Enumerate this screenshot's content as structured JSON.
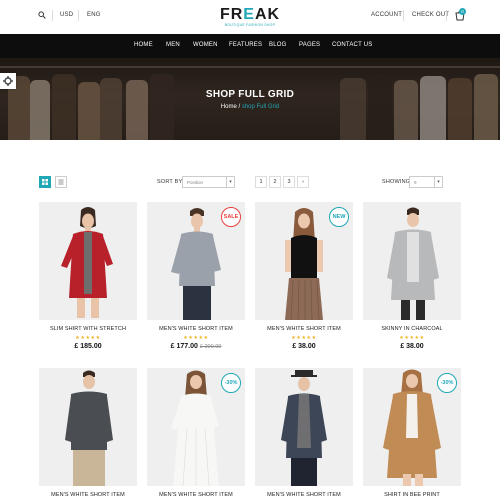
{
  "topbar": {
    "currency": "USD",
    "language": "ENG",
    "account": "ACCOUNT",
    "checkout": "CHECK OUT",
    "cart_count": "0"
  },
  "logo": {
    "main_part1": "FR",
    "main_accent": "E",
    "main_part2": "AK",
    "tagline": "BOUTIQUE FASHION SHOP"
  },
  "nav": {
    "items": [
      "HOME",
      "MEN",
      "WOMEN",
      "FEATURES",
      "BLOG",
      "PAGES",
      "CONTACT US"
    ]
  },
  "hero": {
    "title": "SHOP FULL GRID",
    "breadcrumb_home": "Home",
    "breadcrumb_sep": " / ",
    "breadcrumb_current": "shop Full Grid"
  },
  "toolbar": {
    "sort_label": "SORT BY :",
    "sort_value": "Position",
    "pages": [
      "1",
      "2",
      "3",
      "›"
    ],
    "showing_label": "SHOWING :",
    "showing_value": "9"
  },
  "products": [
    {
      "name": "SLIM SHIRT WITH STRETCH",
      "stars": "★★★★★",
      "price": "£ 185.00",
      "old_price": "",
      "badge": ""
    },
    {
      "name": "MEN'S WHITE SHORT ITEM",
      "stars": "★★★★★",
      "price": "£ 177.00",
      "old_price": "£ 200.00",
      "badge": "SALE"
    },
    {
      "name": "MEN'S WHITE SHORT ITEM",
      "stars": "★★★★★",
      "price": "£ 38.00",
      "old_price": "",
      "badge": "NEW"
    },
    {
      "name": "SKINNY IN CHARCOAL",
      "stars": "★★★★★",
      "price": "£ 38.00",
      "old_price": "",
      "badge": ""
    },
    {
      "name": "MEN'S WHITE SHORT ITEM",
      "stars": "",
      "price": "",
      "old_price": "",
      "badge": ""
    },
    {
      "name": "MEN'S WHITE SHORT ITEM",
      "stars": "",
      "price": "",
      "old_price": "",
      "badge": "-30%"
    },
    {
      "name": "MEN'S WHITE SHORT ITEM",
      "stars": "",
      "price": "",
      "old_price": "",
      "badge": ""
    },
    {
      "name": "SHIRT IN BEE PRINT",
      "stars": "",
      "price": "",
      "old_price": "",
      "badge": "-30%"
    }
  ],
  "colors": {
    "accent": "#20a7b5",
    "sale": "#e8413f",
    "star": "#f0b323",
    "nav_bg": "#0d0d0d"
  },
  "icons": [
    "search-icon",
    "cart-icon",
    "gear-icon",
    "grid-view-icon",
    "list-view-icon",
    "chevron-down-icon"
  ]
}
